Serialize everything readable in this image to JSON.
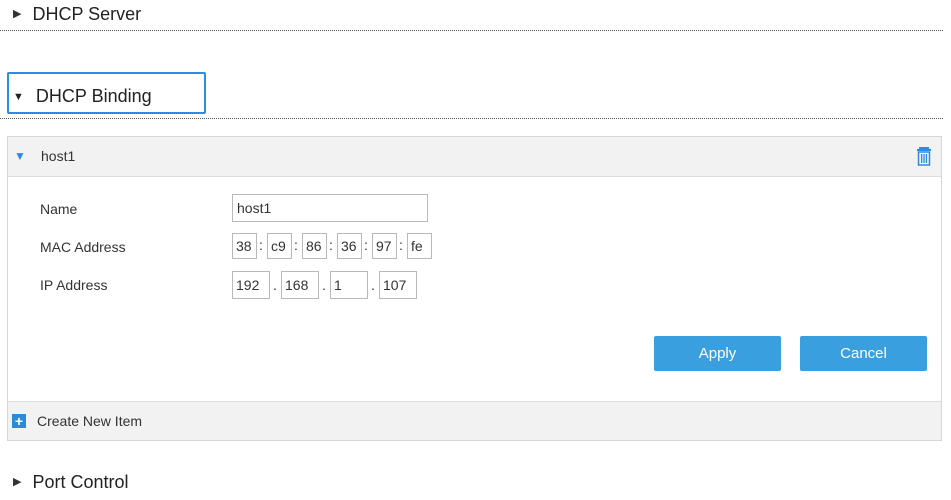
{
  "sections": {
    "dhcp_server": "DHCP Server",
    "dhcp_binding": "DHCP Binding",
    "port_control": "Port Control"
  },
  "binding_item": {
    "name": "host1"
  },
  "form": {
    "name_label": "Name",
    "name_value": "host1",
    "mac_label": "MAC Address",
    "mac": [
      "38",
      "c9",
      "86",
      "36",
      "97",
      "fe"
    ],
    "ip_label": "IP Address",
    "ip": [
      "192",
      "168",
      "1",
      "107"
    ]
  },
  "buttons": {
    "apply": "Apply",
    "cancel": "Cancel"
  },
  "create_new_item": "Create New Item",
  "colors": {
    "accent": "#3a9fdf",
    "focus": "#2a8ce6"
  },
  "icons": {
    "collapsed": "triangle-right-icon",
    "expanded": "triangle-down-icon",
    "delete": "trash-icon",
    "add": "plus-icon"
  }
}
